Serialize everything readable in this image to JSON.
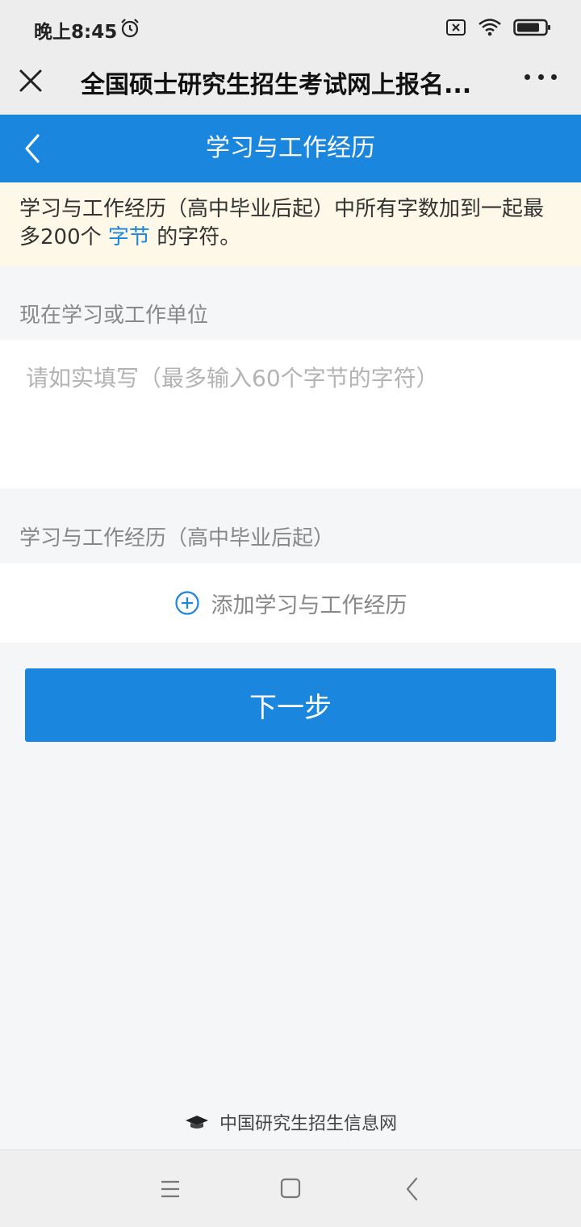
{
  "status_bar": {
    "time": "晚上8:45",
    "icons": [
      "alarm-icon",
      "sim-off-icon",
      "wifi-icon",
      "battery-icon"
    ]
  },
  "wechat_bar": {
    "title": "全国硕士研究生招生考试网上报名...",
    "close_icon": "close-icon",
    "more_icon": "more-icon"
  },
  "header": {
    "title": "学习与工作经历",
    "background": "#1a86de",
    "back_icon": "chevron-left-icon"
  },
  "notice": {
    "text_before": "学习与工作经历（高中毕业后起）中所有字数加到一起最多200个",
    "link": "字节",
    "text_after": "的字符。",
    "background": "#fdf8e7"
  },
  "current_unit": {
    "label": "现在学习或工作单位",
    "placeholder": "请如实填写（最多输入60个字节的字符）",
    "value": ""
  },
  "history": {
    "label": "学习与工作经历（高中毕业后起）",
    "add_label": "添加学习与工作经历",
    "add_icon": "plus-circle-icon"
  },
  "next_button": {
    "label": "下一步",
    "color": "#1a86de"
  },
  "footer": {
    "text": "中国研究生招生信息网",
    "icon": "graduation-cap-icon"
  },
  "nav_bar": {
    "icons": [
      "menu-icon",
      "home-icon",
      "back-icon"
    ]
  }
}
